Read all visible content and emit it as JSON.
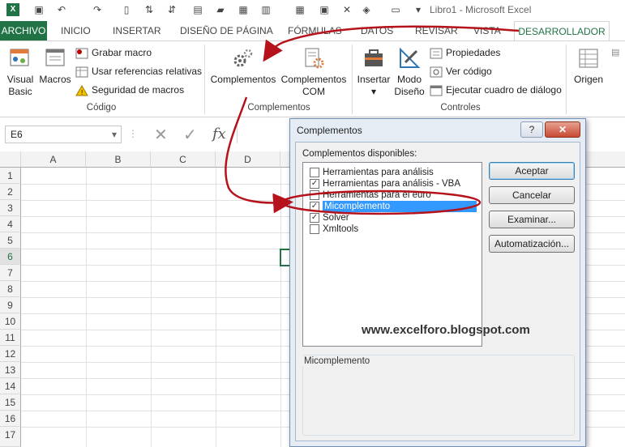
{
  "window": {
    "title": "Libro1 - Microsoft Excel"
  },
  "tabs": [
    "ARCHIVO",
    "INICIO",
    "INSERTAR",
    "DISEÑO DE PÁGINA",
    "FÓRMULAS",
    "DATOS",
    "REVISAR",
    "VISTA",
    "DESARROLLADOR"
  ],
  "ribbon": {
    "codigo": {
      "visual_basic_line1": "Visual",
      "visual_basic_line2": "Basic",
      "macros": "Macros",
      "grabar_macro": "Grabar macro",
      "usar_referencias": "Usar referencias relativas",
      "seguridad_macros": "Seguridad de macros",
      "label": "Código"
    },
    "complementos": {
      "complementos": "Complementos",
      "complementos_com_line1": "Complementos",
      "complementos_com_line2": "COM",
      "label": "Complementos"
    },
    "controles": {
      "insertar": "Insertar",
      "modo_diseno_line1": "Modo",
      "modo_diseno_line2": "Diseño",
      "propiedades": "Propiedades",
      "ver_codigo": "Ver código",
      "ejecutar_dialogo": "Ejecutar cuadro de diálogo",
      "label": "Controles"
    },
    "xml": {
      "origen": "Origen"
    }
  },
  "formula_bar": {
    "name_box": "E6",
    "fx": "fx"
  },
  "grid": {
    "columns": [
      "A",
      "B",
      "C",
      "D"
    ],
    "rows": [
      "1",
      "2",
      "3",
      "4",
      "5",
      "6",
      "7",
      "8",
      "9",
      "10",
      "11",
      "12",
      "13",
      "14",
      "15",
      "16",
      "17"
    ]
  },
  "dialog": {
    "title": "Complementos",
    "help": "?",
    "close": "✕",
    "available_label": "Complementos disponibles:",
    "addins": [
      {
        "label": "Herramientas para análisis",
        "checked": false
      },
      {
        "label": "Herramientas para análisis - VBA",
        "checked": true
      },
      {
        "label": "Herramientas para el euro",
        "checked": false
      },
      {
        "label": "Micomplemento",
        "checked": true,
        "selected": true
      },
      {
        "label": "Solver",
        "checked": true
      },
      {
        "label": "Xmltools",
        "checked": false
      }
    ],
    "buttons": {
      "aceptar": "Aceptar",
      "cancelar": "Cancelar",
      "examinar": "Examinar...",
      "automatizacion": "Automatización..."
    },
    "description_title": "Micomplemento"
  },
  "watermark": "www.excelforo.blogspot.com",
  "colors": {
    "excel_green": "#217346",
    "annotation_red": "#b5121b",
    "selection_blue": "#3399ff"
  }
}
